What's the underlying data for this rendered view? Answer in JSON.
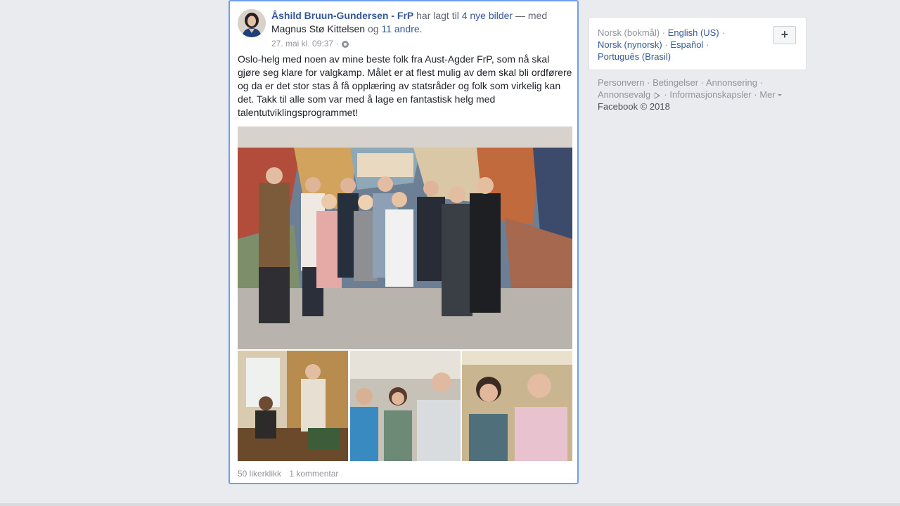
{
  "post": {
    "author": "Åshild Bruun-Gundersen - FrP",
    "action_text": "har lagt til",
    "photos_link": "4 nye bilder",
    "with_text": "— med",
    "tagged_person": "Magnus Stø Kittelsen",
    "and_text": "og",
    "others_link": "11 andre.",
    "timestamp": "27. mai kl. 09:37",
    "separator": "·",
    "privacy_icon": "globe-icon",
    "body": "Oslo-helg med noen av mine beste folk fra Aust-Agder FrP, som nå skal gjøre seg klare for valgkamp. Målet er at flest mulig av dem skal bli ordførere og da er det stor stas å få opplæring av statsråder og folk som virkelig kan det. Takk til alle som var med å lage en fantastisk helg med talentutviklingsprogrammet!",
    "likes": "50 likerklikk",
    "comments": "1 kommentar"
  },
  "sidebar": {
    "languages": {
      "current": "Norsk (bokmål)",
      "options": [
        "English (US)",
        "Norsk (nynorsk)",
        "Español",
        "Português (Brasil)"
      ],
      "sep": "·",
      "add_button": "+"
    },
    "footer": {
      "links": [
        "Personvern",
        "Betingelser",
        "Annonsering",
        "Annonsevalg",
        "Informasjonskapsler",
        "Mer"
      ],
      "sep": "·",
      "copyright": "Facebook © 2018"
    }
  },
  "colors": {
    "link": "#365899",
    "muted": "#90949c",
    "focus_border": "#6d9ef0",
    "page_bg": "#e9ebee"
  }
}
